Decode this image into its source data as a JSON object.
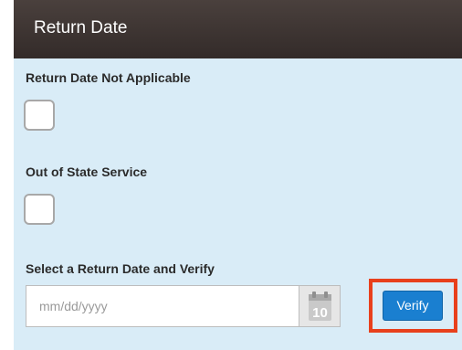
{
  "header": {
    "title": "Return Date"
  },
  "fields": {
    "not_applicable_label": "Return Date Not Applicable",
    "not_applicable_checked": false,
    "out_of_state_label": "Out of State Service",
    "out_of_state_checked": false,
    "select_date_label": "Select a Return Date and Verify"
  },
  "date_input": {
    "placeholder": "mm/dd/yyyy",
    "value": ""
  },
  "calendar": {
    "icon": "calendar-icon",
    "day": "10"
  },
  "verify": {
    "label": "Verify"
  },
  "colors": {
    "panel_bg": "#d9ecf7",
    "header_bg": "#3d3533",
    "accent": "#1a7fd0",
    "highlight": "#e8401c"
  }
}
